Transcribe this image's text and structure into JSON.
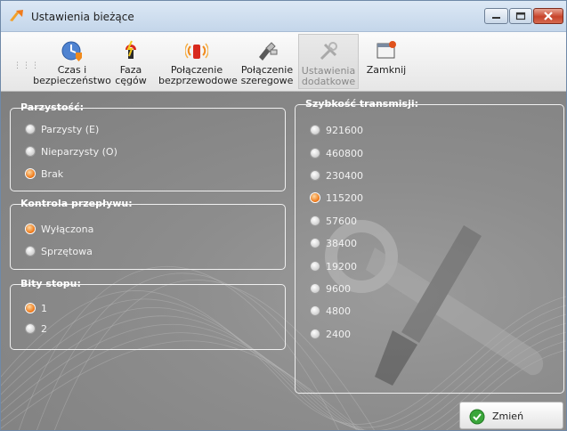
{
  "window": {
    "title": "Ustawienia bieżące",
    "title_icon": "plug-arrow-icon"
  },
  "toolbar": {
    "items": [
      {
        "label1": "Czas i",
        "label2": "bezpieczeństwo",
        "icon": "clock-shield-icon"
      },
      {
        "label1": "Faza",
        "label2": "cęgów",
        "icon": "clamp-phase-icon"
      },
      {
        "label1": "Połączenie",
        "label2": "bezprzewodowe",
        "icon": "wireless-icon"
      },
      {
        "label1": "Połączenie",
        "label2": "szeregowe",
        "icon": "serial-connection-icon"
      },
      {
        "label1": "Ustawienia",
        "label2": "dodatkowe",
        "icon": "tools-icon",
        "disabled": true
      },
      {
        "label1": "Zamknij",
        "label2": "",
        "icon": "close-window-icon"
      }
    ]
  },
  "parity": {
    "title": "Parzystość:",
    "options": [
      "Parzysty (E)",
      "Nieparzysty (O)",
      "Brak"
    ],
    "selected": "Brak"
  },
  "flow": {
    "title": "Kontrola przepływu:",
    "options": [
      "Wyłączona",
      "Sprzętowa"
    ],
    "selected": "Wyłączona"
  },
  "stop": {
    "title": "Bity stopu:",
    "options": [
      "1",
      "2"
    ],
    "selected": "1"
  },
  "baud": {
    "title": "Szybkość transmisji:",
    "options": [
      "921600",
      "460800",
      "230400",
      "115200",
      "57600",
      "38400",
      "19200",
      "9600",
      "4800",
      "2400"
    ],
    "selected": "115200"
  },
  "apply_button": {
    "label": "Zmień",
    "icon": "check-icon"
  },
  "colors": {
    "accent": "#f07b1b",
    "titlebar": "#c4d6ea",
    "panel": "#8d8d8d"
  }
}
